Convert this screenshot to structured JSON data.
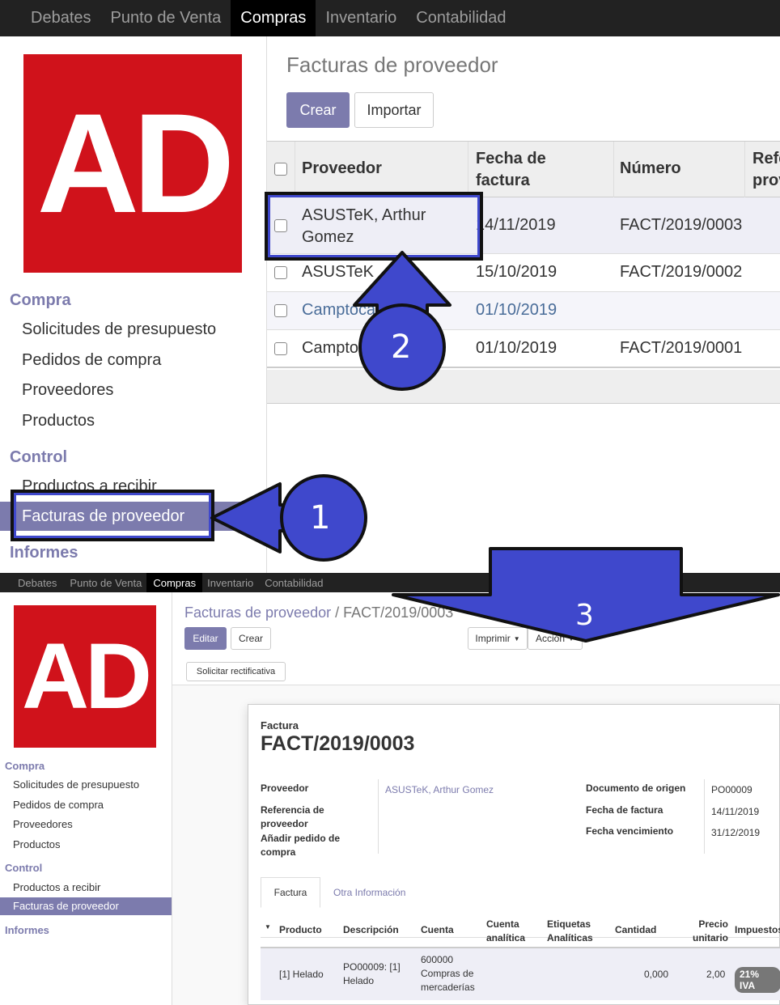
{
  "top": {
    "nav": [
      "Debates",
      "Punto de Venta",
      "Compras",
      "Inventario",
      "Contabilidad"
    ],
    "logo_text": "AD",
    "sidebar": {
      "compra_title": "Compra",
      "compra_items": [
        "Solicitudes de presupuesto",
        "Pedidos de compra",
        "Proveedores",
        "Productos"
      ],
      "control_title": "Control",
      "control_items": [
        "Productos a recibir",
        "Facturas de proveedor"
      ],
      "informes_title": "Informes"
    },
    "page_title": "Facturas de proveedor",
    "create_label": "Crear",
    "import_label": "Importar",
    "columns": [
      "Proveedor",
      "Fecha de factura",
      "Número",
      "Refe prov"
    ],
    "rows": [
      {
        "proveedor": "ASUSTeK, Arthur Gomez",
        "fecha": "14/11/2019",
        "numero": "FACT/2019/0003"
      },
      {
        "proveedor": "ASUSTeK",
        "fecha": "15/10/2019",
        "numero": "FACT/2019/0002"
      },
      {
        "proveedor": "Camptocamp",
        "fecha": "01/10/2019",
        "numero": ""
      },
      {
        "proveedor": "Camptocamp",
        "fecha": "01/10/2019",
        "numero": "FACT/2019/0001"
      }
    ]
  },
  "callouts": [
    "1",
    "2",
    "3"
  ],
  "bottom": {
    "nav": [
      "Debates",
      "Punto de Venta",
      "Compras",
      "Inventario",
      "Contabilidad"
    ],
    "logo_text": "AD",
    "sidebar": {
      "compra_title": "Compra",
      "compra_items": [
        "Solicitudes de presupuesto",
        "Pedidos de compra",
        "Proveedores",
        "Productos"
      ],
      "control_title": "Control",
      "control_items": [
        "Productos a recibir",
        "Facturas de proveedor"
      ],
      "informes_title": "Informes"
    },
    "breadcrumb_parent": "Facturas de proveedor",
    "breadcrumb_sep": "/",
    "breadcrumb_current": "FACT/2019/0003",
    "edit_label": "Editar",
    "create_label": "Crear",
    "print_label": "Imprimir",
    "action_label": "Acción",
    "refund_label": "Solicitar rectificativa",
    "doc_type": "Factura",
    "doc_number": "FACT/2019/0003",
    "fields_left": [
      {
        "label": "Proveedor",
        "value": "ASUSTeK, Arthur Gomez"
      },
      {
        "label": "Referencia de proveedor",
        "value": ""
      },
      {
        "label": "Añadir pedido de compra",
        "value": ""
      }
    ],
    "fields_right": [
      {
        "label": "Documento de origen",
        "value": "PO00009"
      },
      {
        "label": "Fecha de factura",
        "value": "14/11/2019"
      },
      {
        "label": "Fecha vencimiento",
        "value": "31/12/2019"
      }
    ],
    "tabs": [
      "Factura",
      "Otra Información"
    ],
    "line_columns": [
      "Producto",
      "Descripción",
      "Cuenta",
      "Cuenta analítica",
      "Etiquetas Analíticas",
      "Cantidad",
      "Precio unitario",
      "Impuestos"
    ],
    "line": {
      "producto": "[1] Helado",
      "descripcion": "PO00009: [1] Helado",
      "cuenta": "600000 Compras de mercaderías",
      "cuenta_analitica": "",
      "etiquetas": "",
      "cantidad": "0,000",
      "precio": "2,00",
      "impuesto": "21% IVA"
    }
  }
}
